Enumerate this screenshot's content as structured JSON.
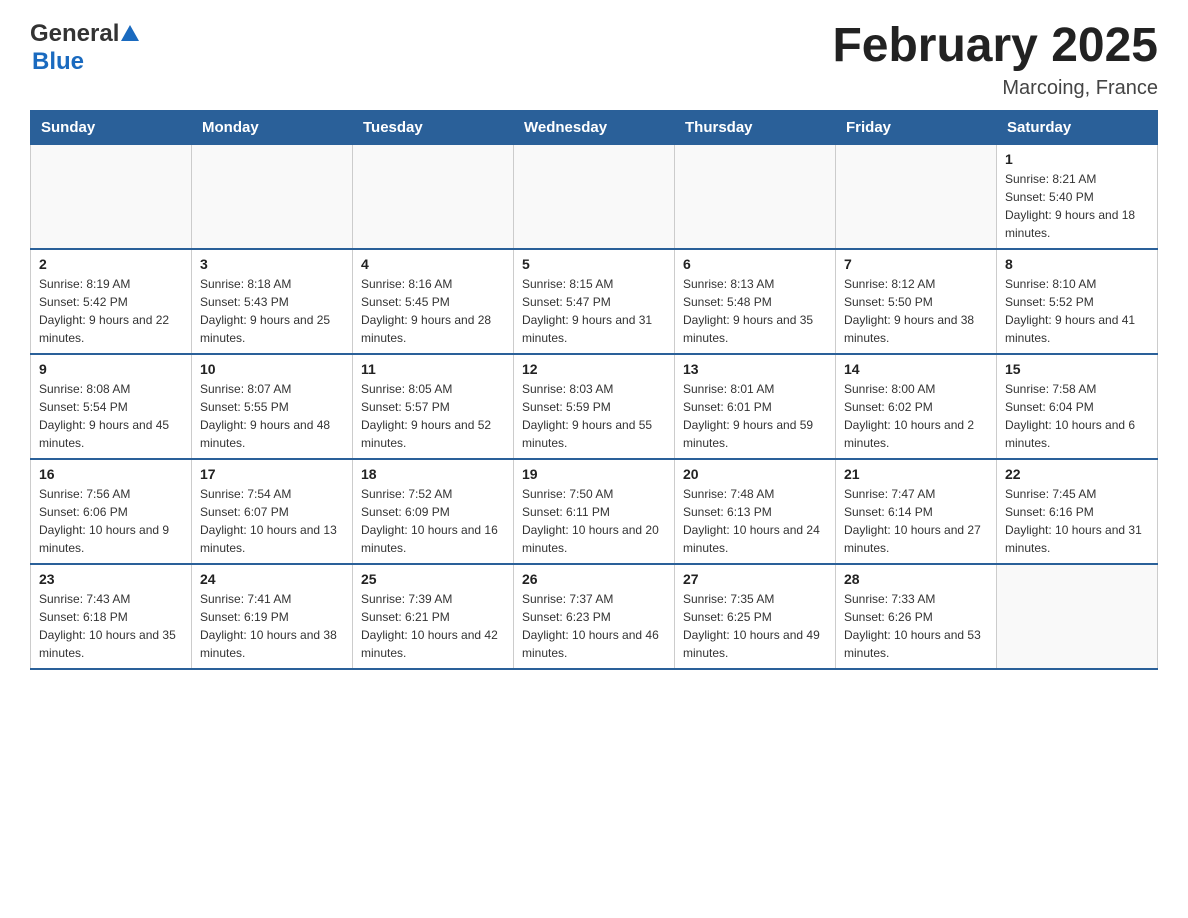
{
  "header": {
    "logo_general": "General",
    "logo_blue": "Blue",
    "main_title": "February 2025",
    "subtitle": "Marcoing, France"
  },
  "days_of_week": [
    "Sunday",
    "Monday",
    "Tuesday",
    "Wednesday",
    "Thursday",
    "Friday",
    "Saturday"
  ],
  "weeks": [
    [
      {
        "day": "",
        "info": ""
      },
      {
        "day": "",
        "info": ""
      },
      {
        "day": "",
        "info": ""
      },
      {
        "day": "",
        "info": ""
      },
      {
        "day": "",
        "info": ""
      },
      {
        "day": "",
        "info": ""
      },
      {
        "day": "1",
        "info": "Sunrise: 8:21 AM\nSunset: 5:40 PM\nDaylight: 9 hours and 18 minutes."
      }
    ],
    [
      {
        "day": "2",
        "info": "Sunrise: 8:19 AM\nSunset: 5:42 PM\nDaylight: 9 hours and 22 minutes."
      },
      {
        "day": "3",
        "info": "Sunrise: 8:18 AM\nSunset: 5:43 PM\nDaylight: 9 hours and 25 minutes."
      },
      {
        "day": "4",
        "info": "Sunrise: 8:16 AM\nSunset: 5:45 PM\nDaylight: 9 hours and 28 minutes."
      },
      {
        "day": "5",
        "info": "Sunrise: 8:15 AM\nSunset: 5:47 PM\nDaylight: 9 hours and 31 minutes."
      },
      {
        "day": "6",
        "info": "Sunrise: 8:13 AM\nSunset: 5:48 PM\nDaylight: 9 hours and 35 minutes."
      },
      {
        "day": "7",
        "info": "Sunrise: 8:12 AM\nSunset: 5:50 PM\nDaylight: 9 hours and 38 minutes."
      },
      {
        "day": "8",
        "info": "Sunrise: 8:10 AM\nSunset: 5:52 PM\nDaylight: 9 hours and 41 minutes."
      }
    ],
    [
      {
        "day": "9",
        "info": "Sunrise: 8:08 AM\nSunset: 5:54 PM\nDaylight: 9 hours and 45 minutes."
      },
      {
        "day": "10",
        "info": "Sunrise: 8:07 AM\nSunset: 5:55 PM\nDaylight: 9 hours and 48 minutes."
      },
      {
        "day": "11",
        "info": "Sunrise: 8:05 AM\nSunset: 5:57 PM\nDaylight: 9 hours and 52 minutes."
      },
      {
        "day": "12",
        "info": "Sunrise: 8:03 AM\nSunset: 5:59 PM\nDaylight: 9 hours and 55 minutes."
      },
      {
        "day": "13",
        "info": "Sunrise: 8:01 AM\nSunset: 6:01 PM\nDaylight: 9 hours and 59 minutes."
      },
      {
        "day": "14",
        "info": "Sunrise: 8:00 AM\nSunset: 6:02 PM\nDaylight: 10 hours and 2 minutes."
      },
      {
        "day": "15",
        "info": "Sunrise: 7:58 AM\nSunset: 6:04 PM\nDaylight: 10 hours and 6 minutes."
      }
    ],
    [
      {
        "day": "16",
        "info": "Sunrise: 7:56 AM\nSunset: 6:06 PM\nDaylight: 10 hours and 9 minutes."
      },
      {
        "day": "17",
        "info": "Sunrise: 7:54 AM\nSunset: 6:07 PM\nDaylight: 10 hours and 13 minutes."
      },
      {
        "day": "18",
        "info": "Sunrise: 7:52 AM\nSunset: 6:09 PM\nDaylight: 10 hours and 16 minutes."
      },
      {
        "day": "19",
        "info": "Sunrise: 7:50 AM\nSunset: 6:11 PM\nDaylight: 10 hours and 20 minutes."
      },
      {
        "day": "20",
        "info": "Sunrise: 7:48 AM\nSunset: 6:13 PM\nDaylight: 10 hours and 24 minutes."
      },
      {
        "day": "21",
        "info": "Sunrise: 7:47 AM\nSunset: 6:14 PM\nDaylight: 10 hours and 27 minutes."
      },
      {
        "day": "22",
        "info": "Sunrise: 7:45 AM\nSunset: 6:16 PM\nDaylight: 10 hours and 31 minutes."
      }
    ],
    [
      {
        "day": "23",
        "info": "Sunrise: 7:43 AM\nSunset: 6:18 PM\nDaylight: 10 hours and 35 minutes."
      },
      {
        "day": "24",
        "info": "Sunrise: 7:41 AM\nSunset: 6:19 PM\nDaylight: 10 hours and 38 minutes."
      },
      {
        "day": "25",
        "info": "Sunrise: 7:39 AM\nSunset: 6:21 PM\nDaylight: 10 hours and 42 minutes."
      },
      {
        "day": "26",
        "info": "Sunrise: 7:37 AM\nSunset: 6:23 PM\nDaylight: 10 hours and 46 minutes."
      },
      {
        "day": "27",
        "info": "Sunrise: 7:35 AM\nSunset: 6:25 PM\nDaylight: 10 hours and 49 minutes."
      },
      {
        "day": "28",
        "info": "Sunrise: 7:33 AM\nSunset: 6:26 PM\nDaylight: 10 hours and 53 minutes."
      },
      {
        "day": "",
        "info": ""
      }
    ]
  ]
}
